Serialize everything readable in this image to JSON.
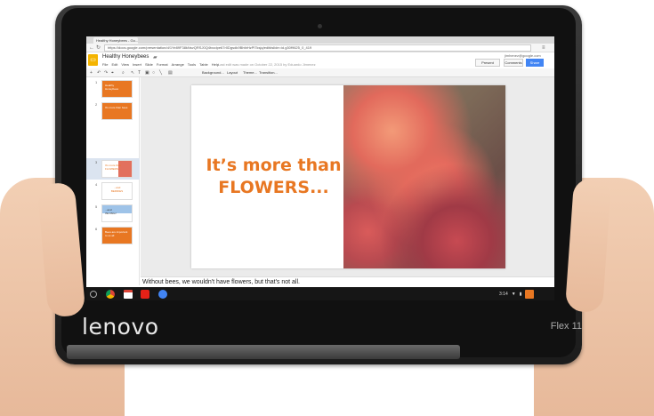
{
  "browser": {
    "tab_title": "Healthy Honeybees - Go...",
    "url": "https://docs.google.com/presentation/d/1Ye89F38kNsvQRSJ0Q4txodpe67r0Dgsdk9BhtbHzPl7ksjq/edit#slide=id.g30f9625_0_419"
  },
  "doc": {
    "title": "Healthy Honeybees",
    "menus": [
      "File",
      "Edit",
      "View",
      "Insert",
      "Slide",
      "Format",
      "Arrange",
      "Tools",
      "Table",
      "Help"
    ],
    "last_edit": "Last edit was made on October 22, 2015 by Eduardo Jimenez",
    "user_email": "jimhenez@google.com",
    "present_label": "Present",
    "comments_label": "Comments",
    "share_label": "Share"
  },
  "toolbar": {
    "background_label": "Background...",
    "layout_label": "Layout",
    "theme_label": "Theme...",
    "transition_label": "Transition..."
  },
  "slides": [
    {
      "num": "1",
      "text": "Healthy\nHoneybees"
    },
    {
      "num": "2",
      "text": "It's more than bees"
    },
    {
      "num": "3",
      "text": "It's more than\nFLOWERS..."
    },
    {
      "num": "4",
      "text": "...and\nBERRIES"
    },
    {
      "num": "5",
      "text": "...and\nthis Mice!"
    },
    {
      "num": "6",
      "text": "Bees are important to us all"
    }
  ],
  "current_slide": {
    "line1": "It’s more than",
    "line2": "FLOWERS..."
  },
  "speaker_notes": "Without bees, we wouldn't have flowers, but that's not all.",
  "shelf": {
    "time": "3:14"
  },
  "device": {
    "brand": "lenovo",
    "model": "Flex 11"
  },
  "colors": {
    "accent_orange": "#e87722",
    "share_blue": "#4285f4",
    "slides_yellow": "#f4b400"
  }
}
